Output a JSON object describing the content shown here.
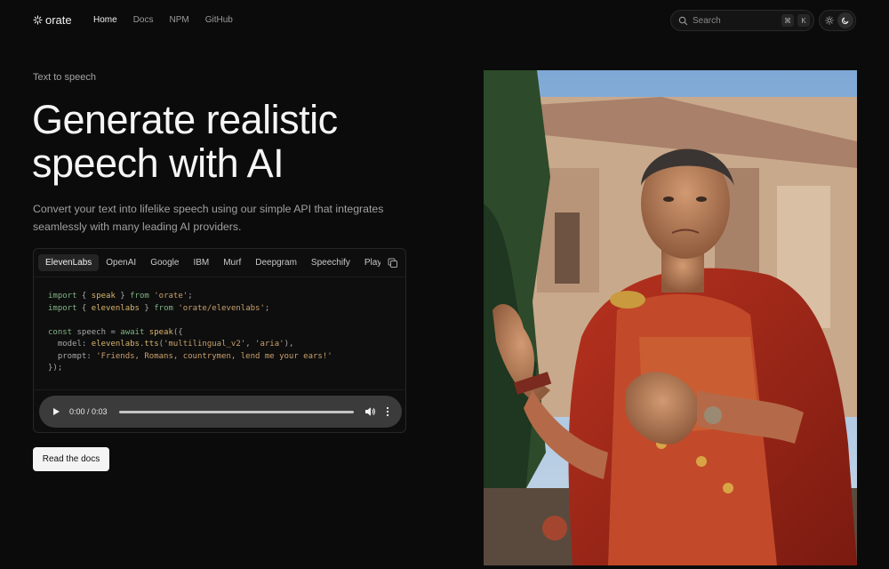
{
  "nav": {
    "logo": "orate",
    "links": [
      "Home",
      "Docs",
      "NPM",
      "GitHub"
    ],
    "search_placeholder": "Search",
    "shortcut_keys": [
      "⌘",
      "K"
    ]
  },
  "hero": {
    "eyebrow": "Text to speech",
    "headline": "Generate realistic speech with AI",
    "subtext": "Convert your text into lifelike speech using our simple API that integrates seamlessly with many leading AI providers.",
    "cta_label": "Read the docs"
  },
  "code_card": {
    "tabs": [
      "ElevenLabs",
      "OpenAI",
      "Google",
      "IBM",
      "Murf",
      "Deepgram",
      "Speechify",
      "Play"
    ],
    "active_tab": "ElevenLabs",
    "code_lines": [
      "import { speak } from 'orate';",
      "import { elevenlabs } from 'orate/elevenlabs';",
      "",
      "const speech = await speak({",
      "  model: elevenlabs.tts('multilingual_v2', 'aria'),",
      "  prompt: 'Friends, Romans, countrymen, lend me your ears!'",
      "});"
    ],
    "audio": {
      "time": "0:00 / 0:03",
      "progress": 0
    }
  },
  "colors": {
    "background": "#0b0b0b",
    "accent_keyword": "#7fb383",
    "accent_string": "#c9a06a"
  }
}
